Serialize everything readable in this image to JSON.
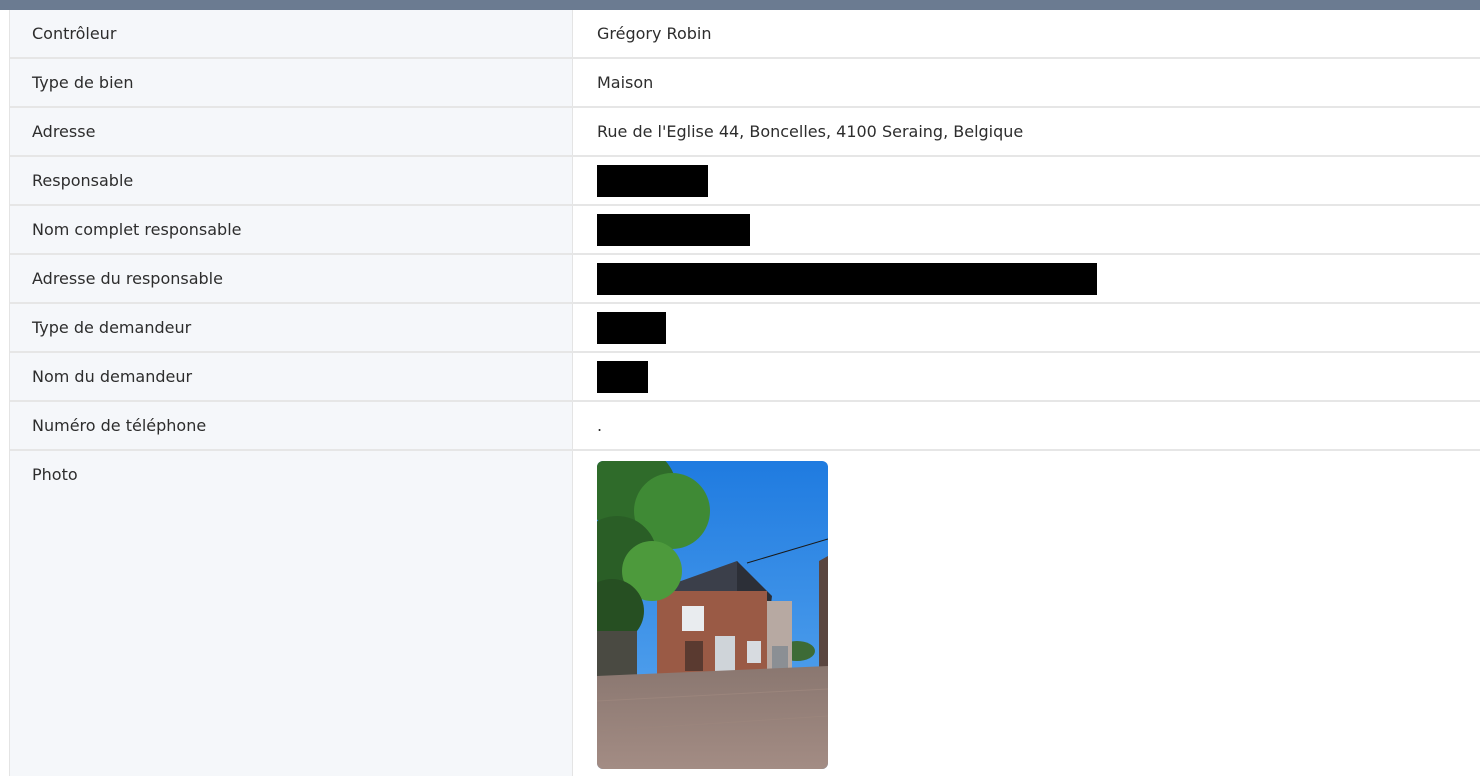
{
  "rows": [
    {
      "label": "Contrôleur",
      "value": "Grégory Robin"
    },
    {
      "label": "Type de bien",
      "value": "Maison"
    },
    {
      "label": "Adresse",
      "value": "Rue de l'Eglise 44, Boncelles, 4100 Seraing, Belgique"
    },
    {
      "label": "Responsable",
      "value": ""
    },
    {
      "label": "Nom complet responsable",
      "value": ""
    },
    {
      "label": "Adresse du responsable",
      "value": ""
    },
    {
      "label": "Type de demandeur",
      "value": ""
    },
    {
      "label": "Nom du demandeur",
      "value": ""
    },
    {
      "label": "Numéro de téléphone",
      "value": "."
    },
    {
      "label": "Photo",
      "value": ""
    }
  ],
  "colors": {
    "header_bar": "#6b7b91",
    "label_bg": "#f5f7fa",
    "border": "#e6e6e6",
    "redaction": "#000000"
  }
}
